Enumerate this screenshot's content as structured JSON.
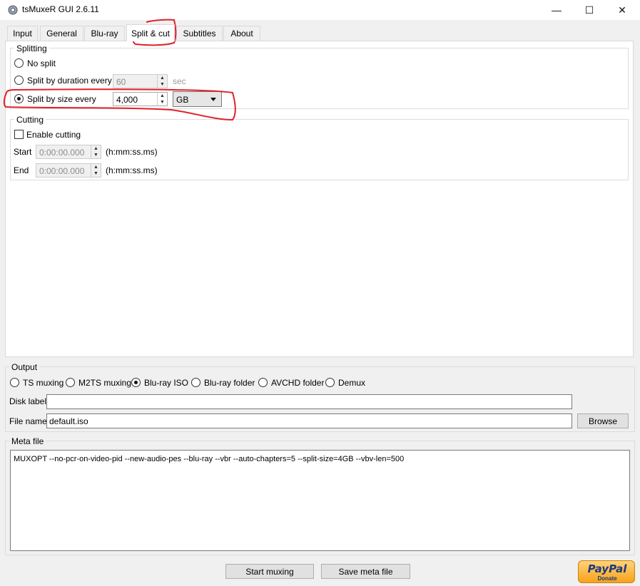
{
  "window": {
    "title": "tsMuxeR GUI 2.6.11"
  },
  "window_buttons": {
    "minimize": "—",
    "maximize": "☐",
    "close": "✕"
  },
  "tabs": [
    {
      "label": "Input"
    },
    {
      "label": "General"
    },
    {
      "label": "Blu-ray"
    },
    {
      "label": "Split & cut"
    },
    {
      "label": "Subtitles"
    },
    {
      "label": "About"
    }
  ],
  "splitting": {
    "group_label": "Splitting",
    "no_split": "No split",
    "split_by_duration": "Split by duration every",
    "duration_value": "60",
    "duration_unit": "sec",
    "split_by_size": "Split by size every",
    "size_value": "4,000",
    "size_unit": "GB"
  },
  "cutting": {
    "group_label": "Cutting",
    "enable_cutting": "Enable cutting",
    "start_label": "Start",
    "start_value": "0:00:00.000",
    "end_label": "End",
    "end_value": "0:00:00.000",
    "time_format": "(h:mm:ss.ms)"
  },
  "output": {
    "group_label": "Output",
    "options": [
      "TS muxing",
      "M2TS muxing",
      "Blu-ray ISO",
      "Blu-ray folder",
      "AVCHD folder",
      "Demux"
    ],
    "selected": "Blu-ray ISO",
    "disk_label": "Disk label",
    "disk_label_value": "",
    "file_name_label": "File name",
    "file_name_value": "default.iso",
    "browse": "Browse"
  },
  "meta": {
    "group_label": "Meta file",
    "text": "MUXOPT --no-pcr-on-video-pid --new-audio-pes --blu-ray --vbr  --auto-chapters=5 --split-size=4GB --vbv-len=500"
  },
  "actions": {
    "start": "Start muxing",
    "save": "Save meta file"
  },
  "paypal": {
    "brand": "PayPal",
    "donate": "Donate"
  },
  "colors": {
    "annotation": "#e0202a",
    "accent": "#0078d7"
  }
}
